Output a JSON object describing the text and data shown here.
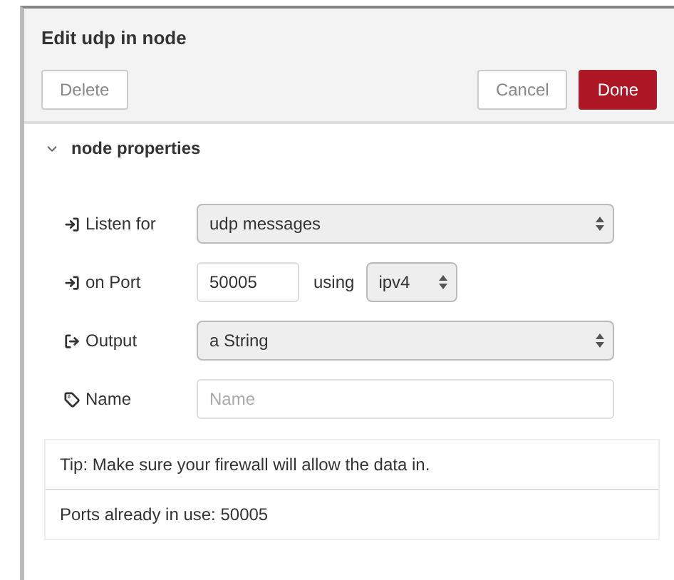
{
  "window": {
    "title": "Edit udp in node"
  },
  "buttons": [
    {
      "label": "Delete",
      "kind": "plain"
    },
    {
      "label": "Cancel",
      "kind": "plain"
    },
    {
      "label": "Done",
      "kind": "primary"
    }
  ],
  "section": {
    "title": "node properties",
    "expanded": true
  },
  "fields": [
    {
      "kind": "select",
      "label": "Listen for",
      "value": "udp messages"
    },
    {
      "kind": "port",
      "label": "on Port",
      "value": "50005",
      "joiner": "using",
      "option": "ipv4"
    },
    {
      "kind": "select",
      "label": "Output",
      "value": "a String"
    },
    {
      "kind": "input",
      "label": "Name",
      "placeholder": "Name"
    }
  ],
  "tips": [
    "Tip: Make sure your firewall will allow the data in.",
    "Ports already in use: 50005"
  ]
}
